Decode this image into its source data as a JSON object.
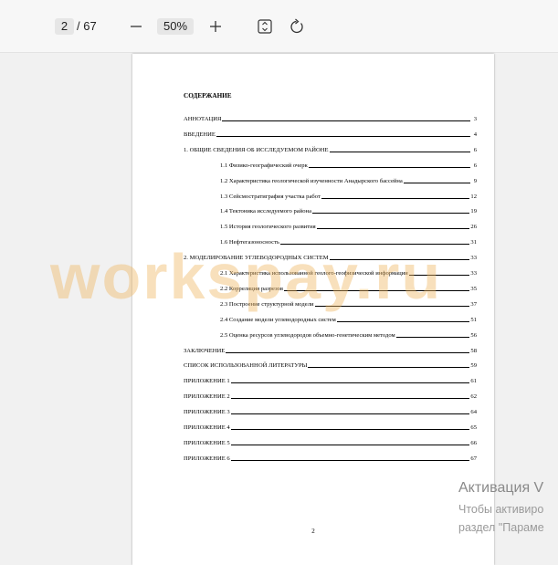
{
  "toolbar": {
    "current_page": "2",
    "total_pages": "/ 67",
    "zoom": "50%",
    "icons": {
      "zoom_out": "minus-icon",
      "zoom_in": "plus-icon",
      "fit": "fit-page-icon",
      "rotate": "rotate-icon"
    }
  },
  "document": {
    "toc_title": "СОДЕРЖАНИЕ",
    "entries": [
      {
        "label": "АННОТАЦИЯ",
        "page": "3",
        "indent": false
      },
      {
        "label": "ВВЕДЕНИЕ",
        "page": "4",
        "indent": false
      },
      {
        "label": "1. ОБЩИЕ СВЕДЕНИЯ ОБ ИССЛЕДУЕМОМ РАЙОНЕ",
        "page": "6",
        "indent": false
      },
      {
        "label": "1.1 Физико-географический очерк",
        "page": "6",
        "indent": true
      },
      {
        "label": "1.2 Характеристика геологической изученности Анадырского бассейна",
        "page": "9",
        "indent": true
      },
      {
        "label": "1.3 Сейсмостратиграфия участка работ",
        "page": "12",
        "indent": true
      },
      {
        "label": "1.4 Тектоника исследуемого района",
        "page": "19",
        "indent": true
      },
      {
        "label": "1.5 История геологического развития",
        "page": "26",
        "indent": true
      },
      {
        "label": "1.6 Нефтегазоносность",
        "page": "31",
        "indent": true
      },
      {
        "label": "2. МОДЕЛИРОВАНИЕ УГЛЕВОДОРОДНЫХ СИСТЕМ",
        "page": "33",
        "indent": false
      },
      {
        "label": "2.1 Характеристика использованной геолого-геофизической информации",
        "page": "33",
        "indent": true
      },
      {
        "label": "2.2 Корреляция разрезов",
        "page": "35",
        "indent": true
      },
      {
        "label": "2.3 Построение структурной модели",
        "page": "37",
        "indent": true
      },
      {
        "label": "2.4 Создание модели углеводородных систем",
        "page": "51",
        "indent": true
      },
      {
        "label": "2.5 Оценка ресурсов углеводородов объемно-генетическим методом",
        "page": "56",
        "indent": true
      },
      {
        "label": "ЗАКЛЮЧЕНИЕ",
        "page": "58",
        "indent": false
      },
      {
        "label": "СПИСОК ИСПОЛЬЗОВАННОЙ ЛИТЕРАТУРЫ",
        "page": "59",
        "indent": false
      },
      {
        "label": "ПРИЛОЖЕНИЕ 1",
        "page": "61",
        "indent": false
      },
      {
        "label": "ПРИЛОЖЕНИЕ 2",
        "page": "62",
        "indent": false
      },
      {
        "label": "ПРИЛОЖЕНИЕ 3",
        "page": "64",
        "indent": false
      },
      {
        "label": "ПРИЛОЖЕНИЕ 4",
        "page": "65",
        "indent": false
      },
      {
        "label": "ПРИЛОЖЕНИЕ 5",
        "page": "66",
        "indent": false
      },
      {
        "label": "ПРИЛОЖЕНИЕ 6",
        "page": "67",
        "indent": false
      }
    ],
    "page_number": "2"
  },
  "watermark": "workspay.ru",
  "activation": {
    "title": "Активация V",
    "line1": "Чтобы активиро",
    "line2": "раздел \"Параме"
  }
}
